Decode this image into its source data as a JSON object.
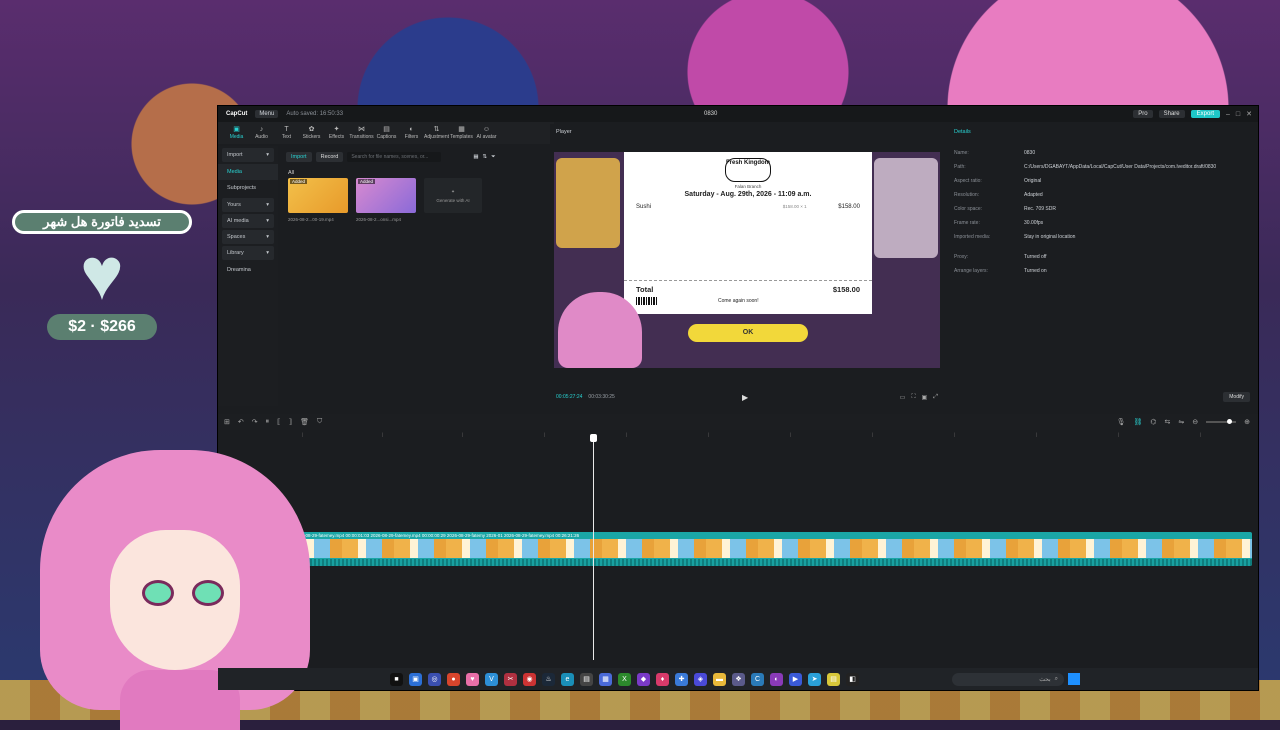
{
  "overlay": {
    "banner": "تسديد فاتورة هل شهر",
    "price": "$2 · $266"
  },
  "app": {
    "logo": "CapCut",
    "menu": "Menu",
    "autosave": "Auto saved: 16:50:33",
    "project": "0830",
    "pro": "Pro",
    "share": "Share",
    "export": "Export"
  },
  "toolbar": [
    {
      "icon": "▣",
      "label": "Media"
    },
    {
      "icon": "♪",
      "label": "Audio"
    },
    {
      "icon": "T",
      "label": "Text"
    },
    {
      "icon": "✿",
      "label": "Stickers"
    },
    {
      "icon": "✦",
      "label": "Effects"
    },
    {
      "icon": "⋈",
      "label": "Transitions"
    },
    {
      "icon": "▤",
      "label": "Captions"
    },
    {
      "icon": "◐",
      "label": "Filters"
    },
    {
      "icon": "⇅",
      "label": "Adjustment"
    },
    {
      "icon": "▦",
      "label": "Templates"
    },
    {
      "icon": "☺",
      "label": "AI avatar"
    }
  ],
  "media_side": {
    "import": "Import",
    "media": "Media",
    "subprojects": "Subprojects",
    "yours": "Yours",
    "ai_media": "AI media",
    "spaces": "Spaces",
    "library": "Library",
    "dreamina": "Dreamina"
  },
  "media": {
    "import_btn": "Import",
    "record_btn": "Record",
    "search_placeholder": "Search for file names, scenes, or...",
    "all": "All",
    "items": [
      {
        "badge": "Added",
        "name": "2026-08-2...00-19.mp4"
      },
      {
        "badge": "Added",
        "name": "2026-08-2...onsi...mp4"
      }
    ],
    "generate": "Generate with AI"
  },
  "player": {
    "title": "Player",
    "time_current": "00:05:27:24",
    "time_total": "00:03:30:25",
    "receipt": {
      "logo": "Fresh Kingdom",
      "branch": "Falan Branch",
      "date": "Saturday - Aug. 29th, 2026 - 11:09 a.m.",
      "item": "Sushi",
      "qty": "$158.00 × 1",
      "item_price": "$158.00",
      "total_label": "Total",
      "total_value": "$158.00",
      "footer": "Come again soon!"
    },
    "ok": "OK"
  },
  "details": {
    "title": "Details",
    "rows": [
      {
        "k": "Name:",
        "v": "0830"
      },
      {
        "k": "Path:",
        "v": "C:/Users/DGABAYT/AppData/Local/CapCut/User Data/Projects/com.lveditor.draft/0830"
      },
      {
        "k": "Aspect ratio:",
        "v": "Original"
      },
      {
        "k": "Resolution:",
        "v": "Adapted"
      },
      {
        "k": "Color space:",
        "v": "Rec. 709 SDR"
      },
      {
        "k": "Frame rate:",
        "v": "30.00fps"
      },
      {
        "k": "Imported media:",
        "v": "Stay in original location"
      },
      {
        "k": "Proxy:",
        "v": "Turned off"
      },
      {
        "k": "Arrange layers:",
        "v": "Turned on"
      }
    ],
    "modify": "Modify"
  },
  "timeline": {
    "clip_label": "2026-08-29-fatemey.mp4  00:00:01:03  2026-08-29-fatemey.mp4  00:00:00:29  2026-08-29-fatemy  2026-01  2026-08-29-fatemey.mp4  00:26:21:26"
  },
  "taskbar": {
    "search": "بحث"
  }
}
